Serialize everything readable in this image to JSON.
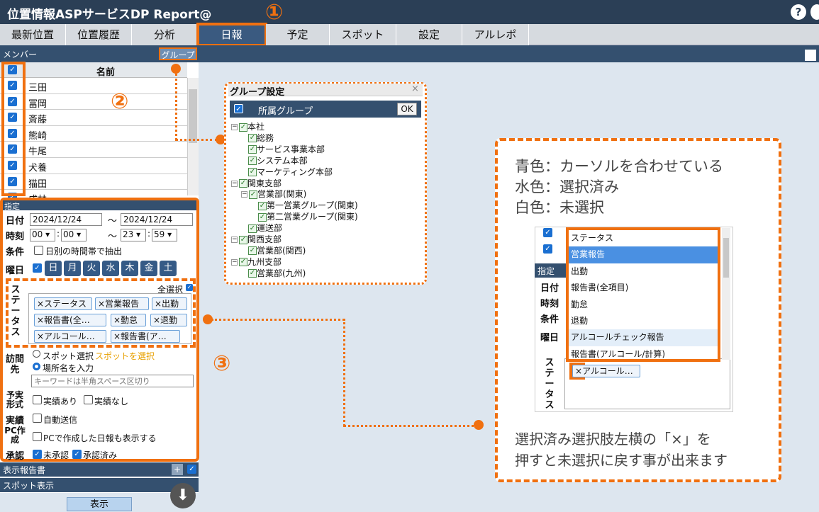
{
  "app": {
    "title": "位置情報ASPサービスDP Report@",
    "help": "?"
  },
  "tabs": [
    "最新位置",
    "位置履歴",
    "分析",
    "日報",
    "予定",
    "スポット",
    "設定",
    "アルレポ"
  ],
  "members": {
    "label": "メンバー",
    "group_button": "グループ",
    "column_name": "名前",
    "rows": [
      "三田",
      "冨岡",
      "斎藤",
      "熊崎",
      "牛尾",
      "犬養",
      "猫田",
      "成林"
    ]
  },
  "spec": {
    "header": "指定",
    "date_label": "日付",
    "date_from": "2024/12/24",
    "tilde": "〜",
    "date_to": "2024/12/24",
    "time_label": "時刻",
    "time_from_h": "00",
    "time_from_m": "00",
    "time_to_h": "23",
    "time_to_m": "59",
    "cond_label": "条件",
    "cond_text": "日別の時間帯で抽出",
    "dow_label": "曜日",
    "days": [
      "日",
      "月",
      "火",
      "水",
      "木",
      "金",
      "土"
    ],
    "select_all": "全選択",
    "status_label": "ステータス",
    "status_chips": [
      "×ステータス",
      "×営業報告",
      "×出勤",
      "×報告書(全…",
      "×勤怠",
      "×退勤",
      "×アルコール…",
      "×報告書(ア…"
    ],
    "visit_label": "訪問先",
    "spot_radio": "スポット選択",
    "spot_link": "スポットを選択",
    "place_radio": "場所名を入力",
    "keyword_placeholder": "キーワードは半角スペース区切り",
    "plan_label": "予実形式",
    "plan_yes": "実績あり",
    "plan_no": "実績なし",
    "actual_label": "実績",
    "auto_send": "自動送信",
    "pc_label": "PC作成",
    "pc_text": "PCで作成した日報も表示する",
    "approval_label": "承認",
    "unapproved": "未承認",
    "approved": "承認済み"
  },
  "bottom": {
    "report_label": "表示報告書",
    "spot_label": "スポット表示",
    "plus": "+",
    "show_button": "表示",
    "down_icon": "⬇"
  },
  "group_dialog": {
    "title": "グループ設定",
    "close": "×",
    "affiliation": "所属グループ",
    "ok": "OK",
    "tree": [
      {
        "t": "本社",
        "lv": 0,
        "exp": "−"
      },
      {
        "t": "総務",
        "lv": 1
      },
      {
        "t": "サービス事業本部",
        "lv": 1
      },
      {
        "t": "システム本部",
        "lv": 1
      },
      {
        "t": "マーケティング本部",
        "lv": 1
      },
      {
        "t": "関東支部",
        "lv": 0,
        "exp": "−"
      },
      {
        "t": "営業部(関東)",
        "lv": 1,
        "exp": "−"
      },
      {
        "t": "第一営業グループ(関東)",
        "lv": 2
      },
      {
        "t": "第二営業グループ(関東)",
        "lv": 2
      },
      {
        "t": "運送部",
        "lv": 1
      },
      {
        "t": "関西支部",
        "lv": 0,
        "exp": "−"
      },
      {
        "t": "営業部(関西)",
        "lv": 1
      },
      {
        "t": "九州支部",
        "lv": 0,
        "exp": "−"
      },
      {
        "t": "営業部(九州)",
        "lv": 1
      }
    ]
  },
  "annotations": {
    "n1": "①",
    "n2": "②",
    "n3": "③"
  },
  "callout": {
    "line1": "青色：カーソルを合わせている",
    "line2": "水色：選択済み",
    "line3": "白色：未選択",
    "bottom1": "選択済み選択肢左横の「×」を",
    "bottom2": "押すと未選択に戻す事が出来ます",
    "dropdown": [
      "ステータス",
      "営業報告",
      "出勤",
      "報告書(全項目)",
      "勤怠",
      "退勤",
      "アルコールチェック報告",
      "報告書(アルコール/計算)"
    ],
    "mini_labels": [
      "指定",
      "日付",
      "時刻",
      "条件",
      "曜日"
    ],
    "mini_status": "ステータス",
    "mini_chip": "アルコール…",
    "x": "×"
  },
  "colors": {
    "accent": "#f07010",
    "nav": "#34506f",
    "highlight": "#4a90e2",
    "selected": "#e3eef9"
  }
}
